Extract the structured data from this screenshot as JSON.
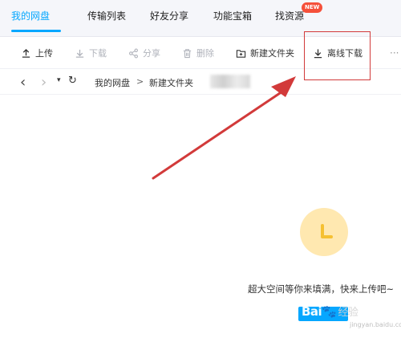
{
  "tabs": [
    {
      "label": "我的网盘",
      "active": true
    },
    {
      "label": "传输列表",
      "active": false
    },
    {
      "label": "好友分享",
      "active": false
    },
    {
      "label": "功能宝箱",
      "active": false
    },
    {
      "label": "找资源",
      "active": false
    }
  ],
  "new_badge": "NEW",
  "toolbar": {
    "upload": "上传",
    "download": "下载",
    "share": "分享",
    "delete": "删除",
    "new_folder": "新建文件夹",
    "offline_download": "离线下载",
    "more": "···"
  },
  "navigation": {
    "back": "‹",
    "forward": "›",
    "history": "▾",
    "refresh": "↻"
  },
  "breadcrumb": {
    "root": "我的网盘",
    "separator": ">",
    "current": "新建文件夹"
  },
  "empty_state": {
    "message": "超大空间等你来填满，快来上传吧~"
  },
  "watermark": {
    "brand": "Bai",
    "paw": "🐾",
    "suffix": "经验",
    "sub": "jingyan.baidu.com"
  },
  "colors": {
    "accent": "#06a7ff",
    "annotation_red": "#d23a3a",
    "empty_icon_bg": "#ffe8b0",
    "empty_icon_fg": "#f5c032"
  }
}
